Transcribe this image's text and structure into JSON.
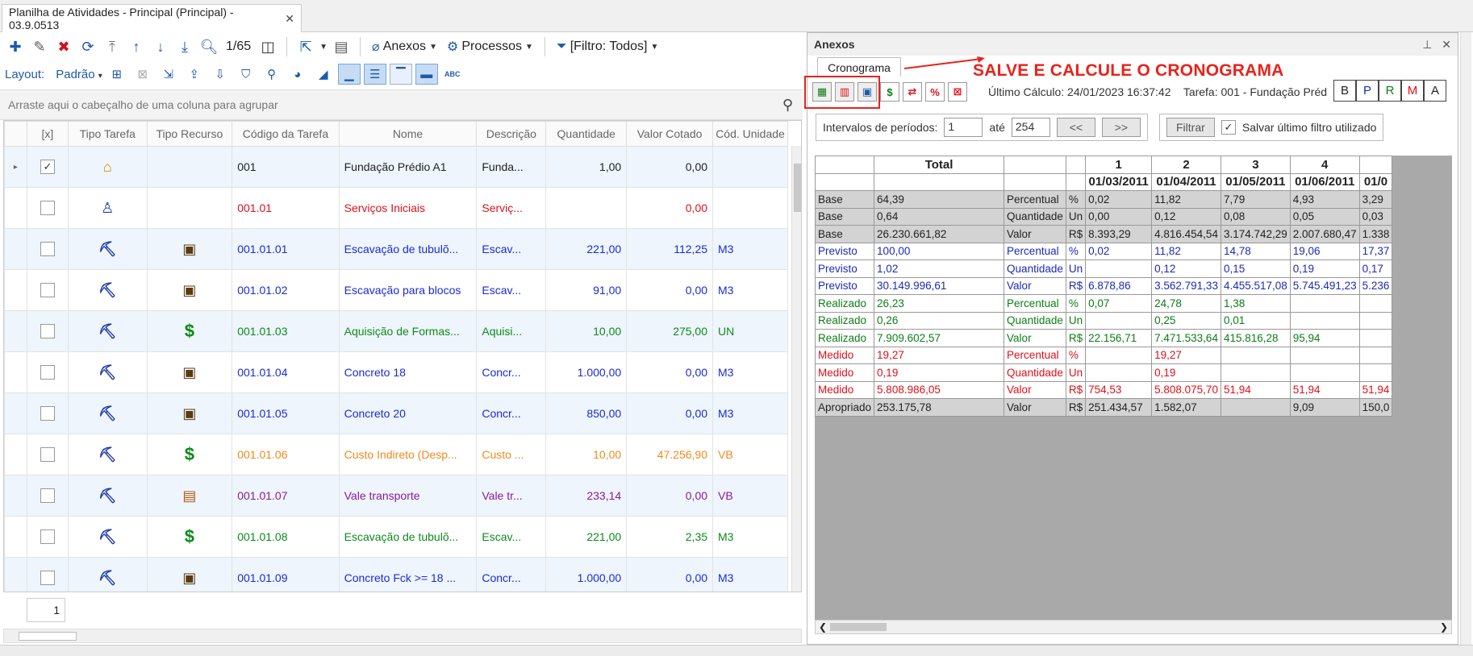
{
  "window": {
    "tab_title": "Planilha de Atividades - Principal (Principal) - 03.9.0513",
    "close": "✕"
  },
  "toolbar": {
    "counter": "1/65",
    "anexos": "Anexos",
    "processos": "Processos",
    "filtro": "[Filtro: Todos]"
  },
  "layout_bar": {
    "layout_label": "Layout:",
    "layout_value": "Padrão"
  },
  "group_area": {
    "placeholder": "Arraste aqui o cabeçalho de uma coluna para agrupar"
  },
  "grid": {
    "columns": [
      "[x]",
      "Tipo Tarefa",
      "Tipo Recurso",
      "Código da Tarefa",
      "Nome",
      "Descrição",
      "Quantidade",
      "Valor Cotado",
      "Cód. Unidade"
    ],
    "rows": [
      {
        "checked": true,
        "tarefa_icon": "house-icon",
        "recurso_icon": "",
        "codigo": "001",
        "nome": "Fundação Prédio A1",
        "descricao": "Funda...",
        "quantidade": "1,00",
        "valor": "0,00",
        "unidade": "",
        "color": "#222222"
      },
      {
        "checked": false,
        "tarefa_icon": "worker-icon",
        "recurso_icon": "",
        "codigo": "001.01",
        "nome": "Serviços Iniciais",
        "descricao": "Serviç...",
        "quantidade": "",
        "valor": "0,00",
        "unidade": "",
        "color": "#e0101a"
      },
      {
        "checked": false,
        "tarefa_icon": "crane-icon",
        "recurso_icon": "machine-icon",
        "codigo": "001.01.01",
        "nome": "Escavação de tubulõ...",
        "descricao": "Escav...",
        "quantidade": "221,00",
        "valor": "112,25",
        "unidade": "M3",
        "color": "#1a2bd8"
      },
      {
        "checked": false,
        "tarefa_icon": "crane-icon",
        "recurso_icon": "machine-icon",
        "codigo": "001.01.02",
        "nome": "Escavação para blocos",
        "descricao": "Escav...",
        "quantidade": "91,00",
        "valor": "0,00",
        "unidade": "M3",
        "color": "#1a2bd8"
      },
      {
        "checked": false,
        "tarefa_icon": "crane-icon",
        "recurso_icon": "dollar-icon",
        "codigo": "001.01.03",
        "nome": "Aquisição de Formas...",
        "descricao": "Aquisi...",
        "quantidade": "10,00",
        "valor": "275,00",
        "unidade": "UN",
        "color": "#0d8a1a"
      },
      {
        "checked": false,
        "tarefa_icon": "crane-icon",
        "recurso_icon": "machine-icon",
        "codigo": "001.01.04",
        "nome": "Concreto 18",
        "descricao": "Concr...",
        "quantidade": "1.000,00",
        "valor": "0,00",
        "unidade": "M3",
        "color": "#1a2bd8"
      },
      {
        "checked": false,
        "tarefa_icon": "crane-icon",
        "recurso_icon": "machine-icon",
        "codigo": "001.01.05",
        "nome": "Concreto 20",
        "descricao": "Concr...",
        "quantidade": "850,00",
        "valor": "0,00",
        "unidade": "M3",
        "color": "#1a2bd8"
      },
      {
        "checked": false,
        "tarefa_icon": "crane-icon",
        "recurso_icon": "dollar-icon",
        "codigo": "001.01.06",
        "nome": "Custo Indireto (Desp...",
        "descricao": "Custo ...",
        "quantidade": "10,00",
        "valor": "47.256,90",
        "unidade": "VB",
        "color": "#f08a1c"
      },
      {
        "checked": false,
        "tarefa_icon": "crane-icon",
        "recurso_icon": "box-icon",
        "codigo": "001.01.07",
        "nome": "Vale transporte",
        "descricao": "Vale tr...",
        "quantidade": "233,14",
        "valor": "0,00",
        "unidade": "VB",
        "color": "#8a1a9a"
      },
      {
        "checked": false,
        "tarefa_icon": "crane-icon",
        "recurso_icon": "dollar-icon",
        "codigo": "001.01.08",
        "nome": "Escavação de tubulõ...",
        "descricao": "Escav...",
        "quantidade": "221,00",
        "valor": "2,35",
        "unidade": "M3",
        "color": "#0d8a1a"
      },
      {
        "checked": false,
        "tarefa_icon": "crane-icon",
        "recurso_icon": "machine-icon",
        "codigo": "001.01.09",
        "nome": "Concreto Fck >= 18 ...",
        "descricao": "Concr...",
        "quantidade": "1.000,00",
        "valor": "0,00",
        "unidade": "M3",
        "color": "#1a2bd8"
      }
    ],
    "page": "1"
  },
  "panel": {
    "title": "Anexos",
    "sub_tab": "Cronograma",
    "annotation": "SALVE E CALCULE O CRONOGRAMA",
    "ultimo_calculo_label": "Último Cálculo:",
    "ultimo_calculo_value": "24/01/2023 16:37:42",
    "tarefa_label": "Tarefa:",
    "tarefa_value": "001 - Fundação Préd",
    "letters": [
      {
        "t": "B",
        "c": "#222222"
      },
      {
        "t": "P",
        "c": "#1a2bb8"
      },
      {
        "t": "R",
        "c": "#0d7d16"
      },
      {
        "t": "M",
        "c": "#e0101a"
      },
      {
        "t": "A",
        "c": "#222222"
      }
    ],
    "filter": {
      "intervalos_label": "Intervalos de  períodos:",
      "from": "1",
      "ate_label": "até",
      "to": "254",
      "prev": "<<",
      "next": ">>",
      "filtrar": "Filtrar",
      "salvar_label": "Salvar último filtro utilizado",
      "salvar_checked": true
    },
    "crono": {
      "total_header": "Total",
      "period_numbers": [
        "1",
        "2",
        "3",
        "4",
        ""
      ],
      "period_dates": [
        "01/03/2011",
        "01/04/2011",
        "01/05/2011",
        "01/06/2011",
        "01/0"
      ],
      "rows": [
        {
          "tipo": "Base",
          "total": "64,39",
          "medida": "Percentual",
          "un": "%",
          "vals": [
            "0,02",
            "11,82",
            "7,79",
            "4,93",
            "3,29"
          ],
          "cls": "clr-black",
          "gray": true
        },
        {
          "tipo": "Base",
          "total": "0,64",
          "medida": "Quantidade",
          "un": "Un",
          "vals": [
            "0,00",
            "0,12",
            "0,08",
            "0,05",
            "0,03"
          ],
          "cls": "clr-black",
          "gray": true
        },
        {
          "tipo": "Base",
          "total": "26.230.661,82",
          "medida": "Valor",
          "un": "R$",
          "vals": [
            "8.393,29",
            "4.816.454,54",
            "3.174.742,29",
            "2.007.680,47",
            "1.338"
          ],
          "cls": "clr-black",
          "gray": true
        },
        {
          "tipo": "Previsto",
          "total": "100,00",
          "medida": "Percentual",
          "un": "%",
          "vals": [
            "0,02",
            "11,82",
            "14,78",
            "19,06",
            "17,37"
          ],
          "cls": "clr-blue",
          "gray": false
        },
        {
          "tipo": "Previsto",
          "total": "1,02",
          "medida": "Quantidade",
          "un": "Un",
          "vals": [
            "",
            "0,12",
            "0,15",
            "0,19",
            "0,17"
          ],
          "cls": "clr-blue",
          "gray": false
        },
        {
          "tipo": "Previsto",
          "total": "30.149.996,61",
          "medida": "Valor",
          "un": "R$",
          "vals": [
            "6.878,86",
            "3.562.791,33",
            "4.455.517,08",
            "5.745.491,23",
            "5.236"
          ],
          "cls": "clr-blue",
          "gray": false
        },
        {
          "tipo": "Realizado",
          "total": "26,23",
          "medida": "Percentual",
          "un": "%",
          "vals": [
            "0,07",
            "24,78",
            "1,38",
            "",
            ""
          ],
          "cls": "clr-green",
          "gray": false
        },
        {
          "tipo": "Realizado",
          "total": "0,26",
          "medida": "Quantidade",
          "un": "Un",
          "vals": [
            "",
            "0,25",
            "0,01",
            "",
            ""
          ],
          "cls": "clr-green",
          "gray": false
        },
        {
          "tipo": "Realizado",
          "total": "7.909.602,57",
          "medida": "Valor",
          "un": "R$",
          "vals": [
            "22.156,71",
            "7.471.533,64",
            "415.816,28",
            "95,94",
            ""
          ],
          "cls": "clr-green",
          "gray": false
        },
        {
          "tipo": "Medido",
          "total": "19,27",
          "medida": "Percentual",
          "un": "%",
          "vals": [
            "",
            "19,27",
            "",
            "",
            ""
          ],
          "cls": "clr-red",
          "gray": false
        },
        {
          "tipo": "Medido",
          "total": "0,19",
          "medida": "Quantidade",
          "un": "Un",
          "vals": [
            "",
            "0,19",
            "",
            "",
            ""
          ],
          "cls": "clr-red",
          "gray": false
        },
        {
          "tipo": "Medido",
          "total": "5.808.986,05",
          "medida": "Valor",
          "un": "R$",
          "vals": [
            "754,53",
            "5.808.075,70",
            "51,94",
            "51,94",
            "51,94"
          ],
          "cls": "clr-red",
          "gray": false
        },
        {
          "tipo": "Apropriado",
          "total": "253.175,78",
          "medida": "Valor",
          "un": "R$",
          "vals": [
            "251.434,57",
            "1.582,07",
            "",
            "9,09",
            "150,0"
          ],
          "cls": "clr-black",
          "gray": true
        }
      ]
    }
  }
}
